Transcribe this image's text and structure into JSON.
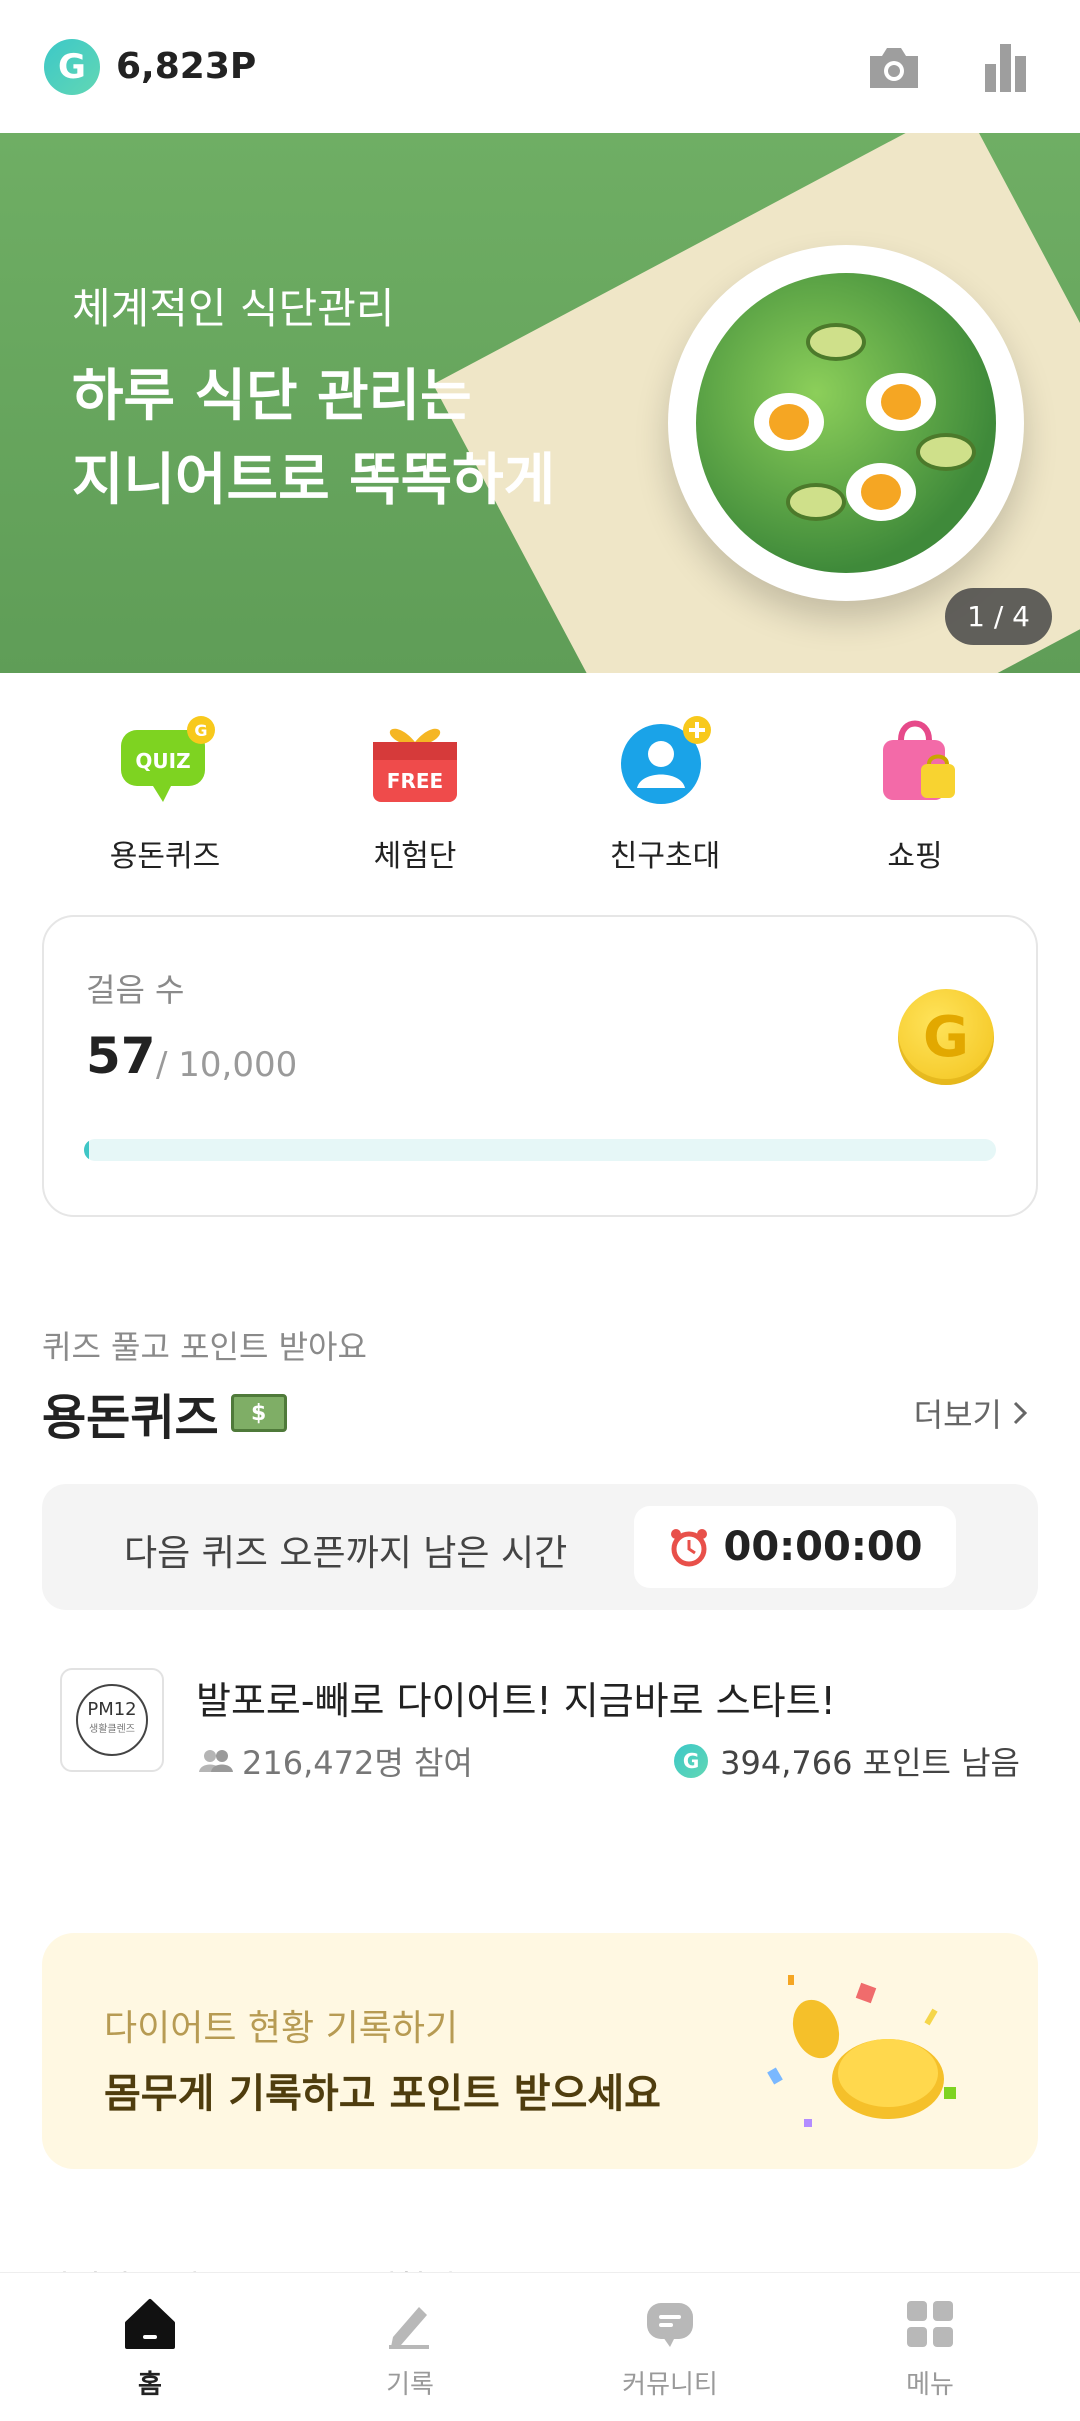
{
  "header": {
    "point_symbol": "G",
    "points": "6,823P",
    "icons": [
      "camera-icon",
      "bar-chart-icon"
    ]
  },
  "banner": {
    "subtitle": "체계적인 식단관리",
    "title": "하루 식단 관리는\n지니어트로 똑똑하게",
    "pager": "1 / 4"
  },
  "quick_menu": {
    "items": [
      {
        "label": "용돈퀴즈",
        "icon": "quiz-icon"
      },
      {
        "label": "체험단",
        "icon": "gift-free-icon"
      },
      {
        "label": "친구초대",
        "icon": "invite-friend-icon"
      },
      {
        "label": "쇼핑",
        "icon": "shopping-bag-icon"
      }
    ]
  },
  "steps": {
    "label": "걸음 수",
    "value": "57",
    "goal": "/ 10,000",
    "coin_symbol": "G",
    "progress_fraction": 0.0057
  },
  "quiz": {
    "subtitle": "퀴즈 풀고 포인트 받아요",
    "title": "용돈퀴즈",
    "money_icon_text": "$",
    "more_label": "더보기",
    "timer_label": "다음 퀴즈 오픈까지 남은 시간",
    "timer_value": "00:00:00",
    "item": {
      "logo_text": "PM12",
      "logo_sub": "생활클렌즈",
      "name": "발포로-빼로 다이어트! 지금바로 스타트!",
      "participants": "216,472명 참여",
      "remaining": "394,766 포인트 남음",
      "point_symbol": "G"
    }
  },
  "diet": {
    "subtitle": "다이어트 현황 기록하기",
    "title": "몸무게 기록하고 포인트 받으세요"
  },
  "peek": {
    "text": "다이어트 레포트 무료로 체험해요"
  },
  "bottom_nav": {
    "items": [
      {
        "label": "홈",
        "icon": "home-icon",
        "active": true
      },
      {
        "label": "기록",
        "icon": "pencil-icon",
        "active": false
      },
      {
        "label": "커뮤니티",
        "icon": "chat-bubble-icon",
        "active": false
      },
      {
        "label": "메뉴",
        "icon": "grid-menu-icon",
        "active": false
      }
    ]
  },
  "colors": {
    "accent": "#3fc6c6",
    "banner_green": "#6fae64",
    "diet_bg": "#fff8e2"
  }
}
